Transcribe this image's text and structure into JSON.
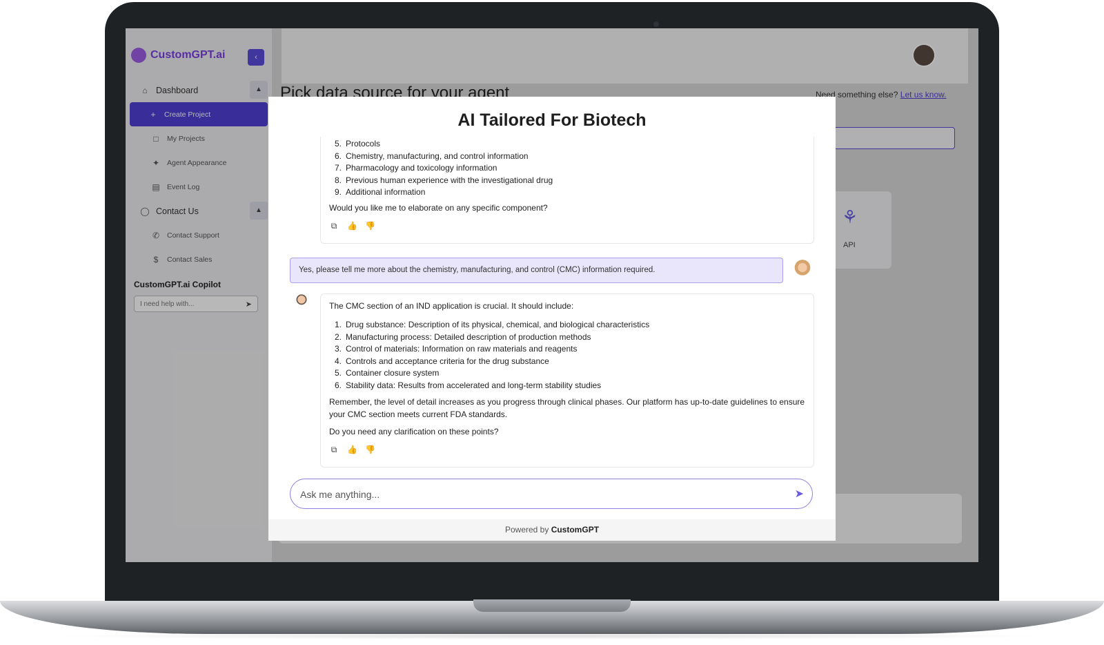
{
  "app": {
    "logo": "CustomGPT.ai",
    "nav": [
      {
        "label": "Dashboard",
        "icon": "home-icon"
      },
      {
        "label": "Create Project",
        "icon": "plus-icon"
      },
      {
        "label": "My Projects",
        "icon": "clipboard-icon"
      },
      {
        "label": "Agent Appearance",
        "icon": "magic-icon"
      },
      {
        "label": "Event Log",
        "icon": "archive-icon"
      },
      {
        "label": "Contact Us",
        "icon": "headset-icon"
      },
      {
        "label": "Contact Support",
        "icon": "phone-icon"
      },
      {
        "label": "Contact Sales",
        "icon": "dollar-icon"
      }
    ],
    "copilot_title": "CustomGPT.ai Copilot",
    "copilot_placeholder": "I need help with...",
    "page_title": "Pick data source for your agent",
    "need_text": "Need something else?",
    "need_link": "Let us know.",
    "api_label": "API"
  },
  "modal": {
    "title": "AI Tailored For Biotech",
    "first_list": [
      {
        "n": "5.",
        "t": "Protocols"
      },
      {
        "n": "6.",
        "t": "Chemistry, manufacturing, and control information"
      },
      {
        "n": "7.",
        "t": "Pharmacology and toxicology information"
      },
      {
        "n": "8.",
        "t": "Previous human experience with the investigational drug"
      },
      {
        "n": "9.",
        "t": "Additional information"
      }
    ],
    "first_question": "Would you like me to elaborate on any specific component?",
    "user_message": "Yes, please tell me more about the chemistry, manufacturing, and control (CMC) information required.",
    "bot_intro": "The CMC section of an IND application is crucial. It should include:",
    "second_list": [
      {
        "n": "1.",
        "t": "Drug substance: Description of its physical, chemical, and biological characteristics"
      },
      {
        "n": "2.",
        "t": "Manufacturing process: Detailed description of production methods"
      },
      {
        "n": "3.",
        "t": "Control of materials: Information on raw materials and reagents"
      },
      {
        "n": "4.",
        "t": "Controls and acceptance criteria for the drug substance"
      },
      {
        "n": "5.",
        "t": "Container closure system"
      },
      {
        "n": "6.",
        "t": "Stability data: Results from accelerated and long-term stability studies"
      }
    ],
    "remember_text": "Remember, the level of detail increases as you progress through clinical phases. Our platform has up-to-date guidelines to ensure your CMC section meets current FDA standards.",
    "second_question": "Do you need any clarification on these points?",
    "ask_placeholder": "Ask me anything...",
    "powered_prefix": "Powered by",
    "powered_brand": "CustomGPT"
  },
  "colors": {
    "accent": "#4f3fd6",
    "user_bubble": "#e9e6fb",
    "user_border": "#a7a0e6"
  }
}
